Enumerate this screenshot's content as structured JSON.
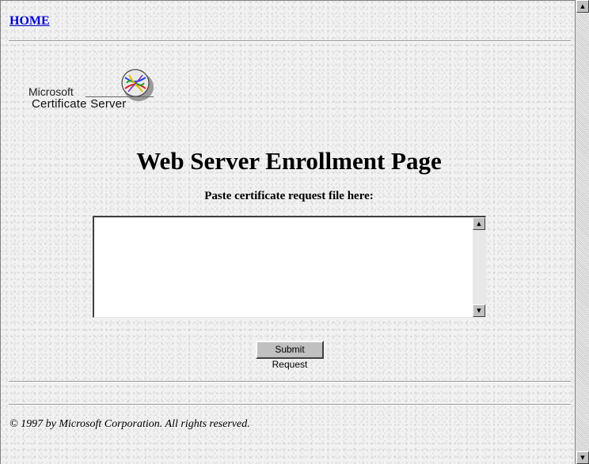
{
  "nav": {
    "home_label": "HOME"
  },
  "logo": {
    "line1": "Microsoft",
    "line2": "Certificate Server"
  },
  "page": {
    "title": "Web Server Enrollment Page",
    "prompt": "Paste certificate request file here:"
  },
  "request_textarea": {
    "value": ""
  },
  "submit_label": "Submit Request",
  "footer": {
    "copyright": "© 1997 by Microsoft Corporation. All rights reserved."
  },
  "icons": {
    "scroll_up": "▲",
    "scroll_down": "▼",
    "logo_icon": "certificate-server-logo-icon"
  }
}
